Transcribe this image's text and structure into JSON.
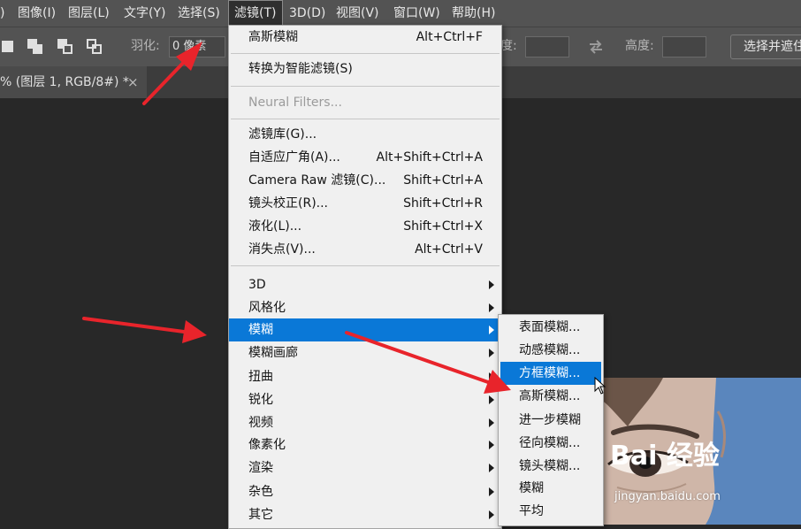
{
  "menubar": {
    "items": [
      {
        "label": ")"
      },
      {
        "label": "图像(I)"
      },
      {
        "label": "图层(L)"
      },
      {
        "label": "文字(Y)"
      },
      {
        "label": "选择(S)"
      },
      {
        "label": "滤镜(T)",
        "active": true
      },
      {
        "label": "3D(D)"
      },
      {
        "label": "视图(V)"
      },
      {
        "label": "窗口(W)"
      },
      {
        "label": "帮助(H)"
      }
    ]
  },
  "options": {
    "feather_label": "羽化:",
    "feather_value": "0 像素",
    "width_label": "度:",
    "height_label": "高度:",
    "select_mask_button": "选择并遮住..."
  },
  "document_tab": {
    "title": "% (图层 1, RGB/8#) *",
    "close": "×"
  },
  "filter_menu": {
    "items": [
      {
        "label": "高斯模糊",
        "shortcut": "Alt+Ctrl+F"
      },
      {
        "label": "转换为智能滤镜(S)",
        "shortcut": ""
      },
      {
        "label": "Neural Filters...",
        "shortcut": "",
        "disabled": true
      },
      {
        "label": "滤镜库(G)...",
        "shortcut": ""
      },
      {
        "label": "自适应广角(A)...",
        "shortcut": "Alt+Shift+Ctrl+A"
      },
      {
        "label": "Camera Raw 滤镜(C)...",
        "shortcut": "Shift+Ctrl+A"
      },
      {
        "label": "镜头校正(R)...",
        "shortcut": "Shift+Ctrl+R"
      },
      {
        "label": "液化(L)...",
        "shortcut": "Shift+Ctrl+X"
      },
      {
        "label": "消失点(V)...",
        "shortcut": "Alt+Ctrl+V"
      },
      {
        "label": "3D",
        "submenu": true
      },
      {
        "label": "风格化",
        "submenu": true
      },
      {
        "label": "模糊",
        "submenu": true,
        "highlighted": true
      },
      {
        "label": "模糊画廊",
        "submenu": true
      },
      {
        "label": "扭曲",
        "submenu": true
      },
      {
        "label": "锐化",
        "submenu": true
      },
      {
        "label": "视频",
        "submenu": true
      },
      {
        "label": "像素化",
        "submenu": true
      },
      {
        "label": "渲染",
        "submenu": true
      },
      {
        "label": "杂色",
        "submenu": true
      },
      {
        "label": "其它",
        "submenu": true
      }
    ]
  },
  "blur_submenu": {
    "items": [
      {
        "label": "表面模糊..."
      },
      {
        "label": "动感模糊..."
      },
      {
        "label": "方框模糊...",
        "highlighted": true
      },
      {
        "label": "高斯模糊..."
      },
      {
        "label": "进一步模糊"
      },
      {
        "label": "径向模糊..."
      },
      {
        "label": "镜头模糊..."
      },
      {
        "label": "模糊"
      },
      {
        "label": "平均"
      }
    ]
  },
  "watermark": {
    "logo": "Bai 经验",
    "url": "jingyan.baidu.com"
  },
  "colors": {
    "highlight": "#0a78d7",
    "arrow": "#e8242b",
    "photo_bg": "#5a86bd"
  }
}
